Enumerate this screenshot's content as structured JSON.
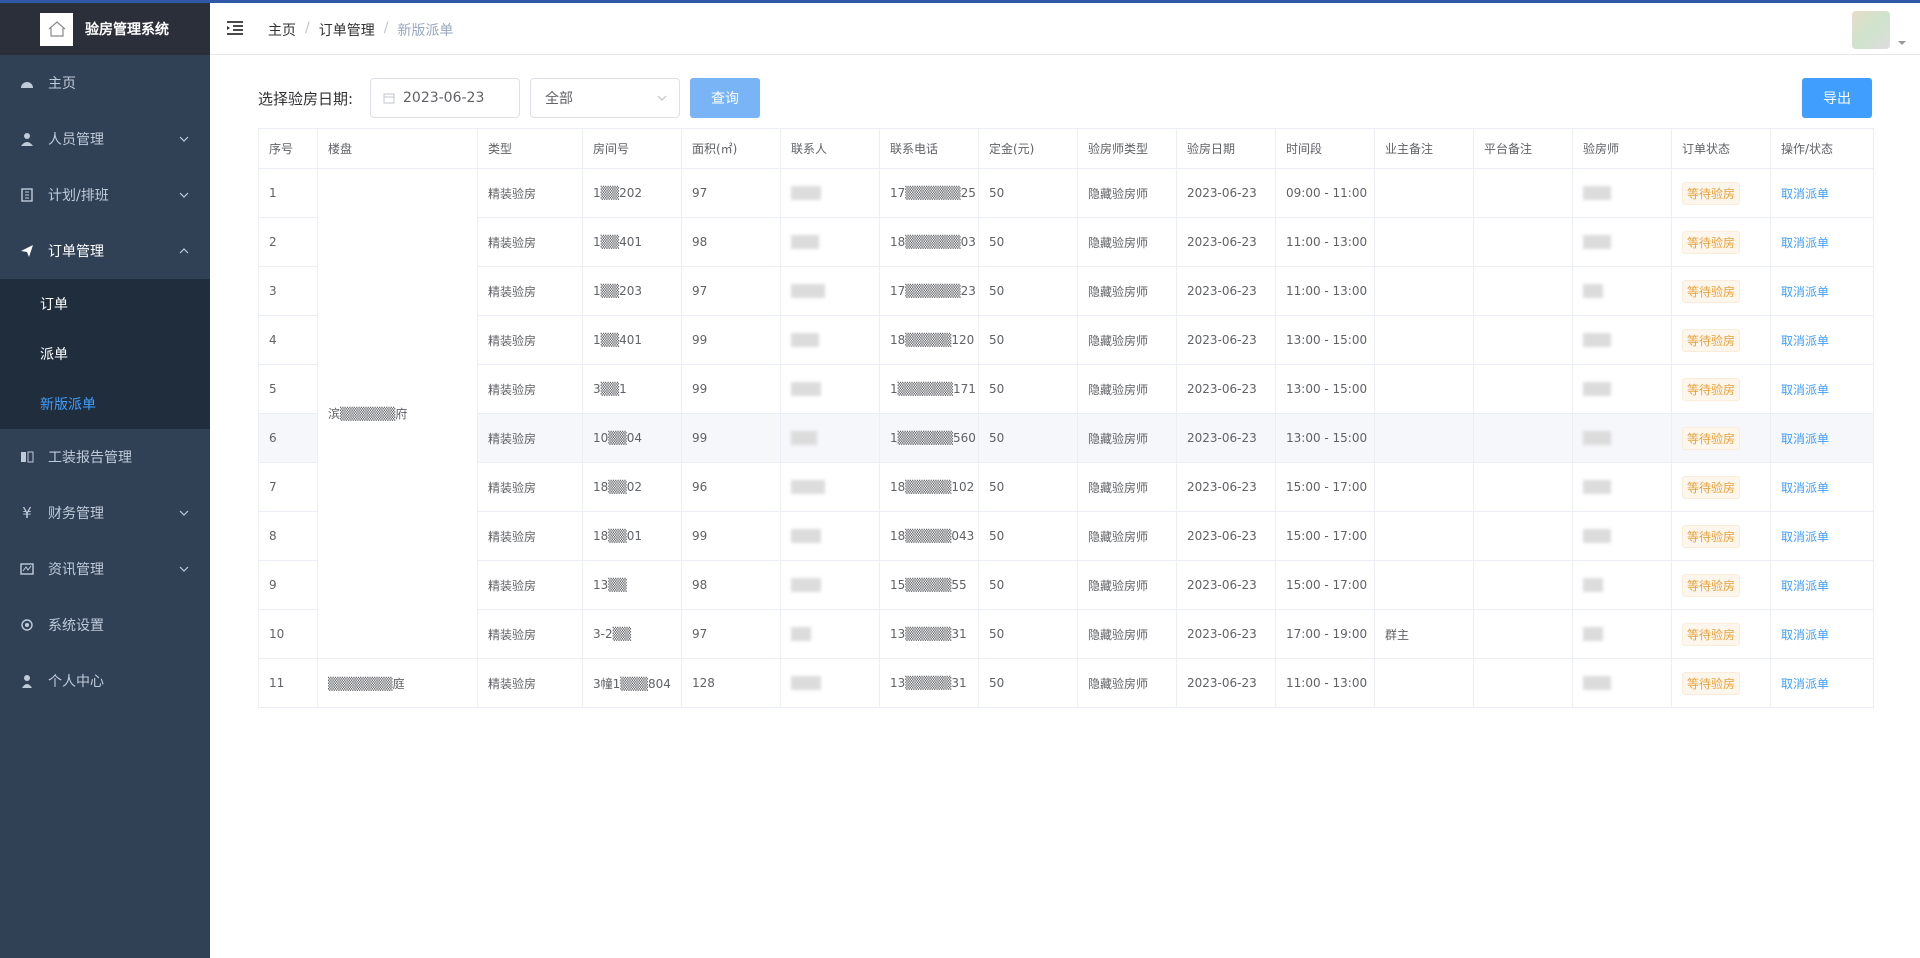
{
  "app": {
    "title": "验房管理系统"
  },
  "sidebar": {
    "items": [
      {
        "label": "主页",
        "icon": "dashboard-icon",
        "has_children": false
      },
      {
        "label": "人员管理",
        "icon": "user-icon",
        "has_children": true
      },
      {
        "label": "计划/排班",
        "icon": "building-icon",
        "has_children": true
      },
      {
        "label": "订单管理",
        "icon": "send-icon",
        "has_children": true,
        "open": true,
        "children": [
          {
            "label": "订单",
            "active": false
          },
          {
            "label": "派单",
            "active": false
          },
          {
            "label": "新版派单",
            "active": true
          }
        ]
      },
      {
        "label": "工装报告管理",
        "icon": "book-icon",
        "has_children": false
      },
      {
        "label": "财务管理",
        "icon": "yen-icon",
        "has_children": true
      },
      {
        "label": "资讯管理",
        "icon": "news-icon",
        "has_children": true
      },
      {
        "label": "系统设置",
        "icon": "gear-icon",
        "has_children": false
      },
      {
        "label": "个人中心",
        "icon": "person-icon",
        "has_children": false
      }
    ]
  },
  "breadcrumb": [
    "主页",
    "订单管理",
    "新版派单"
  ],
  "filter": {
    "label": "选择验房日期:",
    "date": "2023-06-23",
    "select_value": "全部",
    "query_label": "查询",
    "export_label": "导出"
  },
  "table": {
    "columns": [
      "序号",
      "楼盘",
      "类型",
      "房间号",
      "面积(㎡)",
      "联系人",
      "联系电话",
      "定金(元)",
      "验房师类型",
      "验房日期",
      "时间段",
      "业主备注",
      "平台备注",
      "验房师",
      "订单状态",
      "操作/状态"
    ],
    "group1_estate": "滨▒▒▒▒▒▒府",
    "group2_estate": "▒▒▒▒▒▒▒庭",
    "rows": [
      {
        "no": "1",
        "type": "精装验房",
        "room": "1▒▒202",
        "area": "97",
        "phone": "17▒▒▒▒▒▒25",
        "deposit": "50",
        "inspector_type": "隐藏验房师",
        "date": "2023-06-23",
        "slot": "09:00 - 11:00",
        "owner_note": "",
        "platform_note": "",
        "status": "等待验房",
        "op": "取消派单"
      },
      {
        "no": "2",
        "type": "精装验房",
        "room": "1▒▒401",
        "area": "98",
        "phone": "18▒▒▒▒▒▒03",
        "deposit": "50",
        "inspector_type": "隐藏验房师",
        "date": "2023-06-23",
        "slot": "11:00 - 13:00",
        "owner_note": "",
        "platform_note": "",
        "status": "等待验房",
        "op": "取消派单"
      },
      {
        "no": "3",
        "type": "精装验房",
        "room": "1▒▒203",
        "area": "97",
        "phone": "17▒▒▒▒▒▒23",
        "deposit": "50",
        "inspector_type": "隐藏验房师",
        "date": "2023-06-23",
        "slot": "11:00 - 13:00",
        "owner_note": "",
        "platform_note": "",
        "status": "等待验房",
        "op": "取消派单"
      },
      {
        "no": "4",
        "type": "精装验房",
        "room": "1▒▒401",
        "area": "99",
        "phone": "18▒▒▒▒▒120",
        "deposit": "50",
        "inspector_type": "隐藏验房师",
        "date": "2023-06-23",
        "slot": "13:00 - 15:00",
        "owner_note": "",
        "platform_note": "",
        "status": "等待验房",
        "op": "取消派单"
      },
      {
        "no": "5",
        "type": "精装验房",
        "room": "3▒▒1",
        "area": "99",
        "phone": "1▒▒▒▒▒▒171",
        "deposit": "50",
        "inspector_type": "隐藏验房师",
        "date": "2023-06-23",
        "slot": "13:00 - 15:00",
        "owner_note": "",
        "platform_note": "",
        "status": "等待验房",
        "op": "取消派单"
      },
      {
        "no": "6",
        "type": "精装验房",
        "room": "10▒▒04",
        "area": "99",
        "phone": "1▒▒▒▒▒▒560",
        "deposit": "50",
        "inspector_type": "隐藏验房师",
        "date": "2023-06-23",
        "slot": "13:00 - 15:00",
        "owner_note": "",
        "platform_note": "",
        "status": "等待验房",
        "op": "取消派单"
      },
      {
        "no": "7",
        "type": "精装验房",
        "room": "18▒▒02",
        "area": "96",
        "phone": "18▒▒▒▒▒102",
        "deposit": "50",
        "inspector_type": "隐藏验房师",
        "date": "2023-06-23",
        "slot": "15:00 - 17:00",
        "owner_note": "",
        "platform_note": "",
        "status": "等待验房",
        "op": "取消派单"
      },
      {
        "no": "8",
        "type": "精装验房",
        "room": "18▒▒01",
        "area": "99",
        "phone": "18▒▒▒▒▒043",
        "deposit": "50",
        "inspector_type": "隐藏验房师",
        "date": "2023-06-23",
        "slot": "15:00 - 17:00",
        "owner_note": "",
        "platform_note": "",
        "status": "等待验房",
        "op": "取消派单"
      },
      {
        "no": "9",
        "type": "精装验房",
        "room": "13▒▒",
        "area": "98",
        "phone": "15▒▒▒▒▒55",
        "deposit": "50",
        "inspector_type": "隐藏验房师",
        "date": "2023-06-23",
        "slot": "15:00 - 17:00",
        "owner_note": "",
        "platform_note": "",
        "status": "等待验房",
        "op": "取消派单"
      },
      {
        "no": "10",
        "type": "精装验房",
        "room": "3-2▒▒",
        "area": "97",
        "phone": "13▒▒▒▒▒31",
        "deposit": "50",
        "inspector_type": "隐藏验房师",
        "date": "2023-06-23",
        "slot": "17:00 - 19:00",
        "owner_note": "群主",
        "platform_note": "",
        "status": "等待验房",
        "op": "取消派单"
      },
      {
        "no": "11",
        "type": "精装验房",
        "room": "3幢1▒▒▒804",
        "area": "128",
        "phone": "13▒▒▒▒▒31",
        "deposit": "50",
        "inspector_type": "隐藏验房师",
        "date": "2023-06-23",
        "slot": "11:00 - 13:00",
        "owner_note": "",
        "platform_note": "",
        "status": "等待验房",
        "op": "取消派单"
      }
    ]
  },
  "colors": {
    "sidebar_bg": "#304156",
    "accent": "#409eff",
    "status": "#e6a23c"
  }
}
